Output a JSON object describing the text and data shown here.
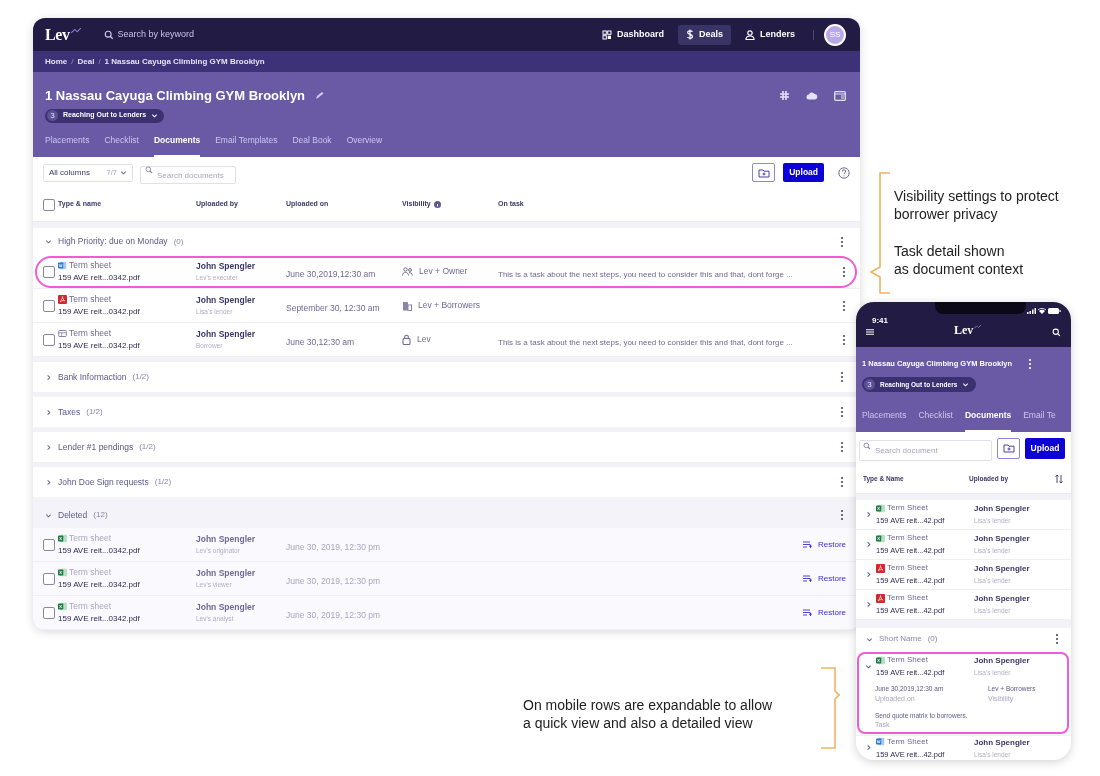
{
  "desktop": {
    "logo": "Lev",
    "search": {
      "placeholder": "Search by keyword"
    },
    "nav": [
      {
        "label": "Dashboard",
        "kind": "grid",
        "selected": false
      },
      {
        "label": "Deals",
        "kind": "dollar",
        "selected": true
      },
      {
        "label": "Lenders",
        "kind": "person",
        "selected": false
      }
    ],
    "avatar": "SS",
    "breadcrumb": {
      "separator": "/",
      "items": [
        "Home",
        "Deal",
        "1 Nassau Cayuga Climbing GYM Brooklyn"
      ]
    },
    "title": "1 Nassau Cayuga Climbing GYM Brooklyn",
    "stage": {
      "number": "3",
      "label": "Reaching Out to Lenders"
    },
    "tabs": [
      {
        "label": "Placements",
        "selected": false
      },
      {
        "label": "Checklist",
        "selected": false
      },
      {
        "label": "Documents",
        "selected": true
      },
      {
        "label": "Email Templates",
        "selected": false
      },
      {
        "label": "Deal Book",
        "selected": false
      },
      {
        "label": "Overview",
        "selected": false
      }
    ],
    "column_filter": {
      "label": "All columns",
      "count": "7/7"
    },
    "search_documents": {
      "placeholder": "Search documents"
    },
    "upload": "Upload",
    "select_all_checked": false,
    "columns": [
      "Type & name",
      "Uploaded by",
      "Uploaded on",
      "Visibility",
      "On task"
    ],
    "groups": [
      {
        "title": "High Priority: due on Monday",
        "count": "(0)",
        "expanded": true,
        "deleted": false,
        "rows": [
          {
            "kind": "word",
            "name": "Term sheet",
            "file": "159 AVE reit...0342.pdf",
            "uploader": "John Spengler",
            "role": "Lev's executer",
            "date": "June 30,2019,12:30 am",
            "visibility": {
              "label": "Lev + Owner",
              "kind": "people"
            },
            "task": "This is a task about the next steps, you need to consider this and that, dont forge  ...",
            "checked": false,
            "highlighted": true
          },
          {
            "kind": "pdf",
            "name": "Term sheet",
            "file": "159 AVE reit...0342.pdf",
            "uploader": "John Spengler",
            "role": "Lisa's lender",
            "date": "September 30, 12:30 am",
            "visibility": {
              "label": "Lev + Borrowers",
              "kind": "building"
            },
            "checked": false,
            "highlighted": false
          },
          {
            "kind": "slides",
            "name": "Term sheet",
            "file": "159 AVE reit...0342.pdf",
            "uploader": "John Spengler",
            "role": "Borrower",
            "date": "June 30,12:30 am",
            "visibility": {
              "label": "Lev",
              "kind": "lock"
            },
            "task": "This is a task about the next steps, you need to consider this and that, dont forge  ...",
            "checked": false,
            "highlighted": false
          }
        ]
      },
      {
        "title": "Bank Informaction",
        "count": "(1/2)",
        "expanded": false,
        "deleted": false
      },
      {
        "title": "Taxes",
        "count": "(1/2)",
        "expanded": false,
        "deleted": false
      },
      {
        "title": "Lender #1 pendings",
        "count": "(1/2)",
        "expanded": false,
        "deleted": false
      },
      {
        "title": "John Doe Sign requests",
        "count": "(1/2)",
        "expanded": false,
        "deleted": false
      },
      {
        "title": "Deleted",
        "count": "(12)",
        "expanded": true,
        "deleted": true,
        "rows": [
          {
            "kind": "excel",
            "name": "Term sheet",
            "file": "159 AVE reit...0342.pdf",
            "uploader": "John Spengler",
            "role": "Lev's originator",
            "date": "June 30, 2019, 12:30 pm",
            "action": "Restore",
            "checked": false,
            "highlighted": false
          },
          {
            "kind": "excel",
            "name": "Term sheet",
            "file": "159 AVE reit...0342.pdf",
            "uploader": "John Spengler",
            "role": "Lev's viewer",
            "date": "June 30, 2019, 12:30 pm",
            "action": "Restore",
            "checked": false,
            "highlighted": false
          },
          {
            "kind": "excel",
            "name": "Term sheet",
            "file": "159 AVE reit...0342.pdf",
            "uploader": "John Spengler",
            "role": "Lev's analyst",
            "date": "June 30, 2019, 12:30 pm",
            "action": "Restore",
            "checked": false,
            "highlighted": false
          }
        ]
      }
    ]
  },
  "phone": {
    "time": "9:41",
    "logo": "Lev",
    "title": "1 Nassau Cayuga Climbing GYM Brooklyn",
    "stage": {
      "number": "3",
      "label": "Reaching Out to Lenders"
    },
    "tabs": [
      {
        "label": "Placements",
        "selected": false
      },
      {
        "label": "Checklist",
        "selected": false
      },
      {
        "label": "Documents",
        "selected": true
      },
      {
        "label": "Email Te",
        "selected": false
      }
    ],
    "search": {
      "placeholder": "Search document"
    },
    "upload": "Upload",
    "columns": [
      "Type & Name",
      "Uploaded by"
    ],
    "rows": [
      {
        "kind": "excel",
        "name": "Term Sheet",
        "file": "159 AVE reit...42.pdf",
        "uploader": "John Spengler",
        "role": "Lisa's lender",
        "expanded": false,
        "highlighted": false
      },
      {
        "kind": "excel",
        "name": "Term Sheet",
        "file": "159 AVE reit...42.pdf",
        "uploader": "John Spengler",
        "role": "Lisa's lender",
        "expanded": false,
        "highlighted": false
      },
      {
        "kind": "pdf",
        "name": "Term Sheet",
        "file": "159 AVE reit...42.pdf",
        "uploader": "John Spengler",
        "role": "Lisa's lender",
        "expanded": false,
        "highlighted": false
      },
      {
        "kind": "pdf",
        "name": "Term Sheet",
        "file": "159 AVE reit...42.pdf",
        "uploader": "John Spengler",
        "role": "Lisa's lender",
        "expanded": false,
        "highlighted": false
      }
    ],
    "group": {
      "title": "Short Name",
      "count": "(0)",
      "expanded": true,
      "rows": [
        {
          "kind": "excel",
          "name": "Term Sheet",
          "file": "159 AVE reit...42.pdf",
          "uploader": "John Spengler",
          "role": "Lisa's lender",
          "expanded": true,
          "highlighted": true,
          "details": [
            {
              "value": "June 30,2019,12:30 am",
              "label": "Uploaded on"
            },
            {
              "value": "Lev + Borrowers",
              "label": "Visibility"
            },
            {
              "value": "Send quote matrix to borrowers.",
              "label": "Task"
            }
          ]
        },
        {
          "kind": "word",
          "name": "Term Sheet",
          "file": "159 AVE reit...42.pdf",
          "uploader": "John Spengler",
          "role": "Lisa's lender",
          "expanded": false,
          "highlighted": false
        }
      ]
    }
  },
  "annotations": [
    {
      "lines": [
        "Visibility settings to protect",
        "borrower privacy"
      ]
    },
    {
      "lines": [
        "Task detail shown",
        "as document context"
      ]
    },
    {
      "lines": [
        "On mobile rows are expandable to allow",
        "a quick view and also a detailed view"
      ]
    }
  ]
}
